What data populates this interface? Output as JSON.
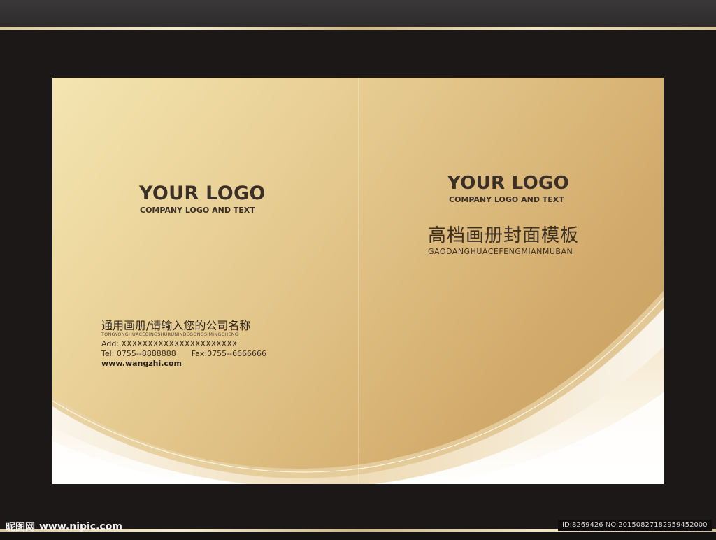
{
  "back_cover": {
    "logo_title": "YOUR LOGO",
    "logo_subtitle": "COMPANY LOGO AND TEXT",
    "company_name": "通用画册/请输入您的公司名称",
    "company_pinyin": "TONGYONGHUACEQINGSHURUNINDEGONGSIMINGCHENG",
    "address": "Add: XXXXXXXXXXXXXXXXXXXXXX",
    "tel": "Tel: 0755--8888888",
    "fax": "Fax:0755--6666666",
    "website": "www.wangzhi.com"
  },
  "front_cover": {
    "logo_title": "YOUR LOGO",
    "logo_subtitle": "COMPANY LOGO AND TEXT",
    "title": "高档画册封面模板",
    "title_pinyin": "GAODANGHUACEFENGMIANMUBAN"
  },
  "footer": {
    "brand": "昵图网",
    "url": "www.nipic.com",
    "image_id": "ID:8269426 NO:20150827182959452000"
  },
  "colors": {
    "frame": "#1c1818",
    "gold_light": "#f4e5b2",
    "gold_dark": "#c59b5a",
    "text_dark": "#3a3027"
  }
}
